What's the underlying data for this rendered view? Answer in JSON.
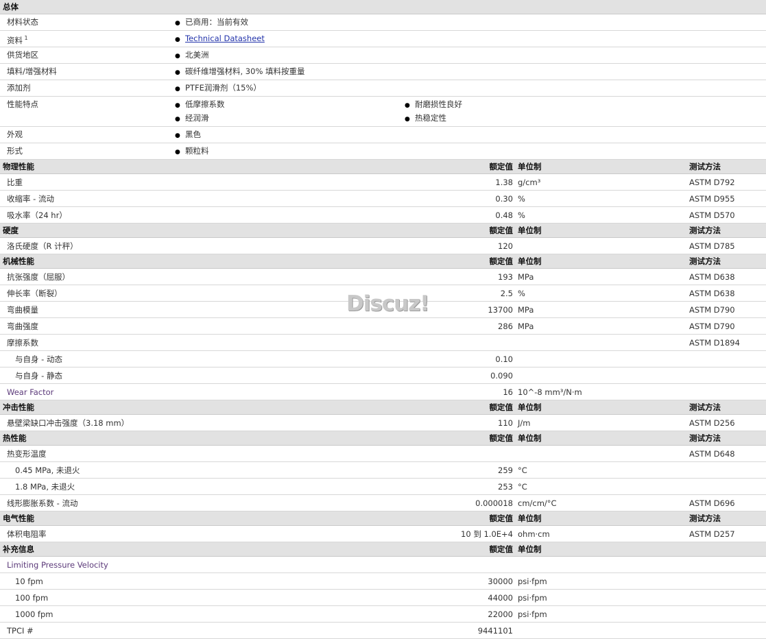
{
  "general": {
    "header": "总体",
    "rows": [
      {
        "label": "材料状态",
        "values": [
          "已商用：当前有效"
        ]
      },
      {
        "label": "资料",
        "sup": "1",
        "values": [
          "Technical Datasheet"
        ],
        "link": true
      },
      {
        "label": "供货地区",
        "values": [
          "北美洲"
        ]
      },
      {
        "label": "填料/增强材料",
        "values": [
          "碳纤维增强材料, 30% 填料按重量"
        ]
      },
      {
        "label": "添加剂",
        "values": [
          "PTFE润滑剂（15%）"
        ]
      },
      {
        "label": "性能特点",
        "values": [
          "低摩擦系数",
          "经润滑"
        ],
        "values2": [
          "耐磨损性良好",
          "热稳定性"
        ]
      },
      {
        "label": "外观",
        "values": [
          "黑色"
        ]
      },
      {
        "label": "形式",
        "values": [
          "颗粒料"
        ]
      }
    ]
  },
  "column_headers": {
    "value": "额定值",
    "unit": "单位制",
    "method": "测试方法"
  },
  "sections": [
    {
      "title": "物理性能",
      "show_method": true,
      "rows": [
        {
          "label": "比重",
          "value": "1.38",
          "unit": "g/cm³",
          "method": "ASTM D792"
        },
        {
          "label": "收缩率  - 流动",
          "value": "0.30",
          "unit": "%",
          "method": "ASTM D955"
        },
        {
          "label": "吸水率（24 hr）",
          "value": "0.48",
          "unit": "%",
          "method": "ASTM D570"
        }
      ]
    },
    {
      "title": "硬度",
      "show_method": true,
      "rows": [
        {
          "label": "洛氏硬度（R 计秤）",
          "value": "120",
          "unit": "",
          "method": "ASTM D785"
        }
      ]
    },
    {
      "title": "机械性能",
      "show_method": true,
      "rows": [
        {
          "label": "抗张强度（屈服）",
          "value": "193",
          "unit": "MPa",
          "method": "ASTM D638"
        },
        {
          "label": "伸长率（断裂）",
          "value": "2.5",
          "unit": "%",
          "method": "ASTM D638"
        },
        {
          "label": "弯曲模量",
          "value": "13700",
          "unit": "MPa",
          "method": "ASTM D790"
        },
        {
          "label": "弯曲强度",
          "value": "286",
          "unit": "MPa",
          "method": "ASTM D790"
        },
        {
          "label": "摩擦系数",
          "value": "",
          "unit": "",
          "method": "ASTM D1894"
        },
        {
          "label": "与自身  - 动态",
          "value": "0.10",
          "unit": "",
          "method": "",
          "indent": true
        },
        {
          "label": "与自身  - 静态",
          "value": "0.090",
          "unit": "",
          "method": "",
          "indent": true
        },
        {
          "label": "Wear Factor",
          "value": "16",
          "unit": "10^-8 mm³/N·m",
          "method": "",
          "purple": true
        }
      ]
    },
    {
      "title": "冲击性能",
      "show_method": true,
      "rows": [
        {
          "label": "悬壁梁缺口冲击强度（3.18 mm）",
          "value": "110",
          "unit": "J/m",
          "method": "ASTM D256"
        }
      ]
    },
    {
      "title": "热性能",
      "show_method": true,
      "rows": [
        {
          "label": "热变形温度",
          "value": "",
          "unit": "",
          "method": "ASTM D648"
        },
        {
          "label": "0.45 MPa, 未退火",
          "value": "259",
          "unit": "°C",
          "method": "",
          "indent": true
        },
        {
          "label": "1.8 MPa, 未退火",
          "value": "253",
          "unit": "°C",
          "method": "",
          "indent": true
        },
        {
          "label": "线形膨胀系数  - 流动",
          "value": "0.000018",
          "unit": "cm/cm/°C",
          "method": "ASTM D696"
        }
      ]
    },
    {
      "title": "电气性能",
      "show_method": true,
      "rows": [
        {
          "label": "体积电阻率",
          "value": "10 到  1.0E+4",
          "unit": "ohm·cm",
          "method": "ASTM D257"
        }
      ]
    },
    {
      "title": "补充信息",
      "show_method": false,
      "rows": [
        {
          "label": "Limiting Pressure Velocity",
          "value": "",
          "unit": "",
          "method": "",
          "purple": true
        },
        {
          "label": "10 fpm",
          "value": "30000",
          "unit": "psi·fpm",
          "method": "",
          "indent": true
        },
        {
          "label": "100 fpm",
          "value": "44000",
          "unit": "psi·fpm",
          "method": "",
          "indent": true
        },
        {
          "label": "1000 fpm",
          "value": "22000",
          "unit": "psi·fpm",
          "method": "",
          "indent": true
        },
        {
          "label": "TPCI #",
          "value": "9441101",
          "unit": "",
          "method": ""
        }
      ]
    }
  ],
  "watermark": "Discuz!"
}
